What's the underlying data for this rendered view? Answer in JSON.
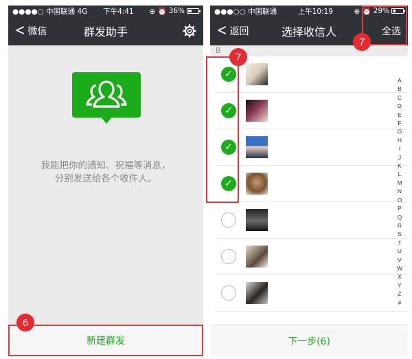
{
  "left_screen": {
    "status": {
      "carrier": "●●●●○ 中国联通  4G",
      "time": "下午4:41",
      "icons": "⊕ ⏰",
      "battery": "36%",
      "battery_level": 0.36
    },
    "nav": {
      "back_label": "微信",
      "title": "群发助手",
      "settings_icon": "gear-icon"
    },
    "description_line1": "我能把你的通知、祝福等消息，",
    "description_line2": "分别发送给各个收件人。",
    "new_broadcast_label": "新建群发",
    "marker": "6"
  },
  "right_screen": {
    "status": {
      "carrier": "●●●○○ 中国联通",
      "time": "上午10:19",
      "icons": "⊕ ⏰",
      "battery": "29%",
      "battery_level": 0.29
    },
    "nav": {
      "back_label": "返回",
      "title": "选择收信人",
      "select_all_label": "全选"
    },
    "section_letter": "B",
    "contacts": [
      {
        "name": "",
        "checked": true
      },
      {
        "name": "",
        "checked": true
      },
      {
        "name": "",
        "checked": true
      },
      {
        "name": "",
        "checked": true
      },
      {
        "name": "",
        "checked": false
      },
      {
        "name": "",
        "checked": false
      },
      {
        "name": "",
        "checked": false
      }
    ],
    "index_letters": [
      "A",
      "B",
      "C",
      "D",
      "E",
      "F",
      "G",
      "H",
      "I",
      "J",
      "K",
      "L",
      "M",
      "N",
      "O",
      "P",
      "Q",
      "R",
      "S",
      "T",
      "U",
      "V",
      "W",
      "X",
      "Y",
      "Z",
      "#"
    ],
    "next_step_label": "下一步(6)",
    "marker_checks": "7",
    "marker_select_all": "7"
  },
  "colors": {
    "accent_green": "#1aad19",
    "nav_bar": "#2f3338",
    "highlight_red": "#e03a3a",
    "marker_red": "#e8292f"
  }
}
